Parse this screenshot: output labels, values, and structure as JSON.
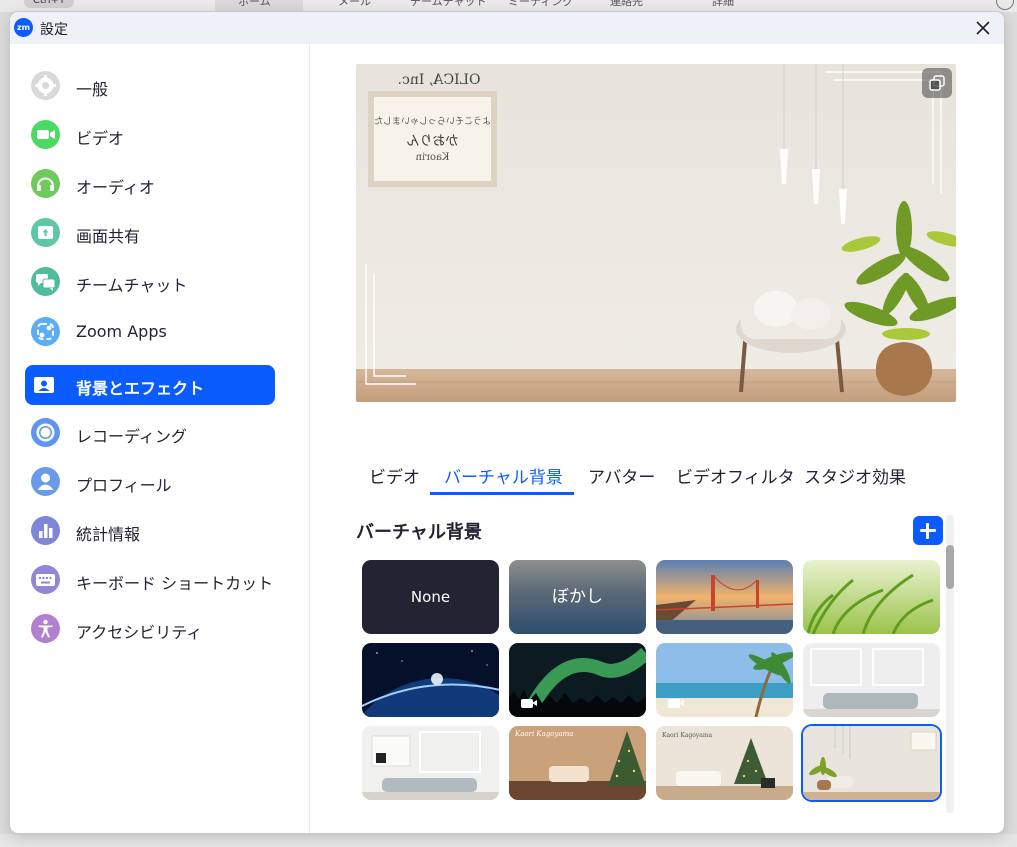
{
  "background_app": {
    "shortcut": "Ctrl+T",
    "tabs": [
      "ホーム",
      "メール",
      "チームチャット",
      "ミーティング",
      "連絡先",
      "詳細"
    ]
  },
  "window": {
    "title": "設定",
    "logo_text": "zm",
    "close_icon": "close-icon"
  },
  "sidebar": {
    "items": [
      {
        "label": "一般",
        "icon": "gear-icon",
        "color": "#d9d9d9"
      },
      {
        "label": "ビデオ",
        "icon": "video-camera-icon",
        "color": "#4cd964"
      },
      {
        "label": "オーディオ",
        "icon": "headphones-icon",
        "color": "#6fc95b"
      },
      {
        "label": "画面共有",
        "icon": "share-screen-icon",
        "color": "#5ec7a8"
      },
      {
        "label": "チームチャット",
        "icon": "chat-bubbles-icon",
        "color": "#4fbc9c"
      },
      {
        "label": "Zoom Apps",
        "icon": "apps-icon",
        "color": "#5aaef5"
      },
      {
        "label": "背景とエフェクト",
        "icon": "portrait-icon",
        "color": "#ffffff",
        "active": true
      },
      {
        "label": "レコーディング",
        "icon": "record-icon",
        "color": "#5e95f2"
      },
      {
        "label": "プロフィール",
        "icon": "person-icon",
        "color": "#6b9be8"
      },
      {
        "label": "統計情報",
        "icon": "bar-chart-icon",
        "color": "#7e86d8"
      },
      {
        "label": "キーボード ショートカット",
        "icon": "keyboard-icon",
        "color": "#8f88d9"
      },
      {
        "label": "アクセシビリティ",
        "icon": "accessibility-icon",
        "color": "#b37fd0"
      }
    ]
  },
  "preview": {
    "frame_title": "OLICA, Inc.",
    "frame_line1": "ようこそいらっしゃいました",
    "frame_line2": "かおりん",
    "frame_line3": "Kaorin",
    "copy_icon": "copy-icon"
  },
  "tabs": [
    {
      "label": "ビデオ"
    },
    {
      "label": "バーチャル背景",
      "active": true
    },
    {
      "label": "アバター"
    },
    {
      "label": "ビデオフィルタ"
    },
    {
      "label": "スタジオ効果"
    }
  ],
  "virtual_backgrounds": {
    "title": "バーチャル背景",
    "add_icon": "plus-icon",
    "items": [
      {
        "label": "None",
        "kind": "none"
      },
      {
        "label": "ぼかし",
        "kind": "blur"
      },
      {
        "label": "",
        "kind": "golden-gate-bridge"
      },
      {
        "label": "",
        "kind": "grass"
      },
      {
        "label": "",
        "kind": "earth-from-space"
      },
      {
        "label": "",
        "kind": "aurora",
        "video": true
      },
      {
        "label": "",
        "kind": "beach",
        "video": true
      },
      {
        "label": "",
        "kind": "white-room"
      },
      {
        "label": "",
        "kind": "white-room-qr"
      },
      {
        "label": "",
        "kind": "christmas-room",
        "caption": "Kaori Kagoyama"
      },
      {
        "label": "",
        "kind": "christmas-tree-room",
        "caption": "Kaori Kagoyama"
      },
      {
        "label": "",
        "kind": "olica-room",
        "selected": true
      }
    ]
  }
}
